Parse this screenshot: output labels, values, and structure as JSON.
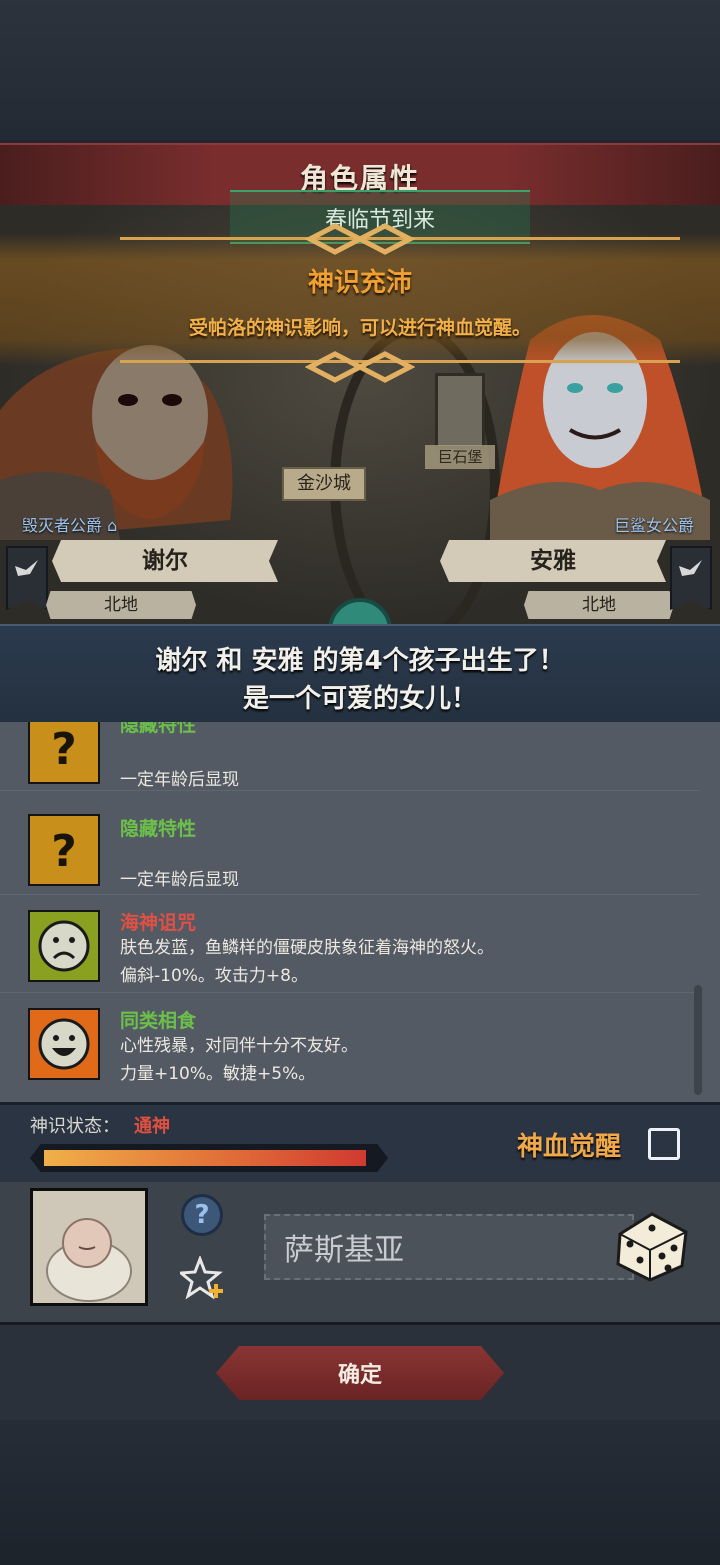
{
  "header": {
    "title": "角色属性"
  },
  "banner": {
    "title": "神识充沛",
    "text": "受帕洛的神识影响，可以进行神血觉醒。"
  },
  "scene": {
    "festival": "春临节到来",
    "city": "金沙城",
    "city2": "巨石堡"
  },
  "father": {
    "rank": "毁灭者公爵",
    "name": "谢尔",
    "region": "北地"
  },
  "mother": {
    "rank": "巨鲨女公爵",
    "name": "安雅",
    "region": "北地"
  },
  "message": {
    "line1": "谢尔 和 安雅 的第4个孩子出生了！",
    "line2": "是一个可爱的女儿！"
  },
  "traits": [
    {
      "name": "隐藏特性",
      "desc1": "",
      "desc2": "一定年龄后显现",
      "color": "#6cc04a",
      "icon": "question-icon"
    },
    {
      "name": "隐藏特性",
      "desc1": "",
      "desc2": "一定年龄后显现",
      "color": "#6cc04a",
      "icon": "question-icon"
    },
    {
      "name": "海神诅咒",
      "desc1": "肤色发蓝，鱼鳞样的僵硬皮肤象征着海神的怒火。",
      "desc2": "偏斜-10%。攻击力+8。",
      "color": "#e05044",
      "icon": "sad-face-icon"
    },
    {
      "name": "同类相食",
      "desc1": "心性残暴，对同伴十分不友好。",
      "desc2": "力量+10%。敏捷+5%。",
      "color": "#6cc04a",
      "icon": "happy-face-icon"
    }
  ],
  "divine_state": {
    "label": "神识状态：",
    "value": "通神",
    "progress": 0.97
  },
  "awaken": {
    "label": "神血觉醒",
    "checked": false
  },
  "baby": {
    "name": "萨斯基亚"
  },
  "confirm_label": "确定",
  "colors": {
    "accent": "#f0a848",
    "trait_good": "#6cc04a",
    "trait_bad": "#e05044",
    "confirm": "#7a2d2d"
  }
}
